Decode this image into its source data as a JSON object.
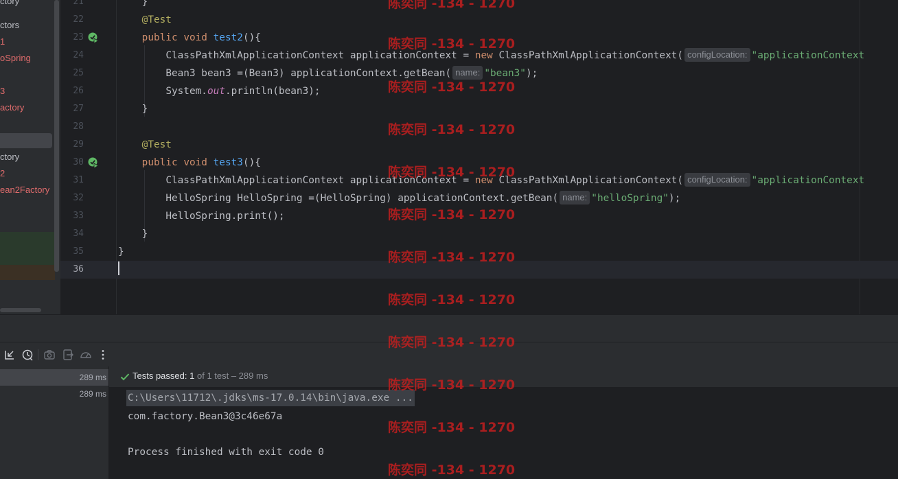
{
  "project_tree": {
    "items": [
      {
        "label": "ctory",
        "color": "#bcbec4"
      },
      {
        "label": "ctors",
        "color": "#bcbec4"
      },
      {
        "label": "1",
        "color": "#e06c6c"
      },
      {
        "label": "oSpring",
        "color": "#e06c6c"
      },
      {
        "label": "3",
        "color": "#e06c6c"
      },
      {
        "label": "actory",
        "color": "#e06c6c"
      },
      {
        "label": "ctory",
        "color": "#bcbec4"
      },
      {
        "label": "2",
        "color": "#e06c6c"
      },
      {
        "label": "ean2Factory",
        "color": "#e06c6c"
      }
    ]
  },
  "editor": {
    "current_line": "36",
    "lines": [
      {
        "num": "21"
      },
      {
        "num": "22"
      },
      {
        "num": "23"
      },
      {
        "num": "24"
      },
      {
        "num": "25"
      },
      {
        "num": "26"
      },
      {
        "num": "27"
      },
      {
        "num": "28"
      },
      {
        "num": "29"
      },
      {
        "num": "30"
      },
      {
        "num": "31"
      },
      {
        "num": "32"
      },
      {
        "num": "33"
      },
      {
        "num": "34"
      },
      {
        "num": "35"
      },
      {
        "num": "36"
      }
    ],
    "tokens": {
      "brace_close": "}",
      "test_annotation": "@Test",
      "kw_public": "public",
      "kw_void": "void",
      "method_test2": "test2",
      "method_test3": "test3",
      "paren_open_brace": "(){",
      "ctx_decl": "ClassPathXmlApplicationContext applicationContext = ",
      "kw_new": "new",
      "ctx_ctor": " ClassPathXmlApplicationContext(",
      "hint_config": "configLocation:",
      "str_config": "\"applicationContext",
      "bean3_decl": "Bean3 bean3 =(Bean3) applicationContext.getBean(",
      "hint_name": "name:",
      "str_bean3": "\"bean3\"",
      "close_stmt": ");",
      "system": "System.",
      "out": "out",
      "println_bean3": ".println(bean3);",
      "hello_decl": "HelloSpring HelloSpring =(HelloSpring) applicationContext.getBean(",
      "str_hello": "\"helloSpring\"",
      "hello_print": "HelloSpring.print();"
    }
  },
  "run_panel": {
    "test_tree": [
      {
        "time": "289 ms"
      },
      {
        "time": "289 ms"
      }
    ],
    "status": {
      "passed_label": "Tests passed:",
      "passed_count": "1",
      "of_text": "of 1 test – 289 ms"
    },
    "console": {
      "command": "C:\\Users\\11712\\.jdks\\ms-17.0.14\\bin\\java.exe ...",
      "output_1": "com.factory.Bean3@3c46e67a",
      "output_2": "Process finished with exit code 0"
    }
  },
  "watermark": {
    "text": "陈奕同 -134 - 1270"
  },
  "colors": {
    "background": "#1e1f22",
    "panel": "#2b2d30",
    "keyword": "#cf8e6d",
    "annotation": "#b3ae60",
    "function": "#56a8f5",
    "string": "#6aab73",
    "success": "#5fb865",
    "watermark": "#c81e1e"
  }
}
